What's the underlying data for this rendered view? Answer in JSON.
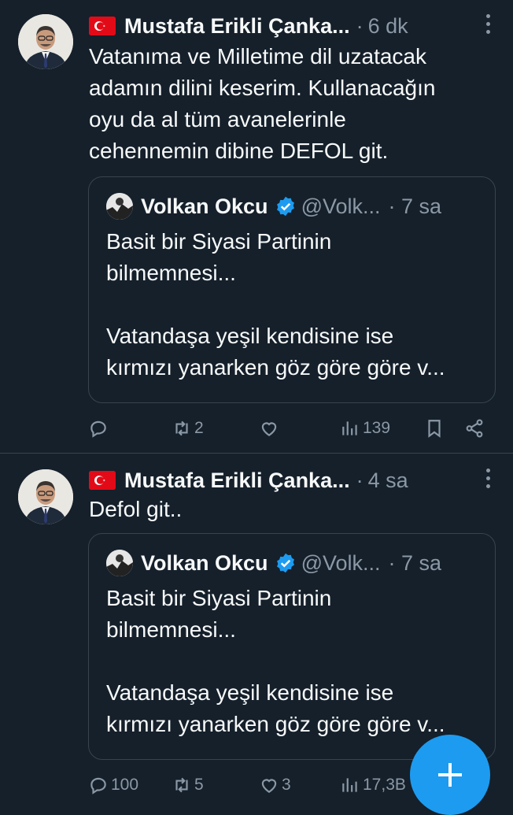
{
  "tweets": [
    {
      "author": "Mustafa Erikli Çanka...",
      "time": "6 dk",
      "text_lines": [
        "Vatanıma ve Milletime dil uzatacak",
        "adamın dilini keserim. Kullanacağın",
        "oyu da al tüm avanelerinle",
        "cehennemin dibine DEFOL git."
      ],
      "quote": {
        "author": "Volkan Okcu",
        "handle": "@Volk...",
        "time": "7 sa",
        "lines": [
          "Basit bir Siyasi Partinin",
          "bilmemnesi...",
          "",
          "Vatandaşa yeşil kendisine ise",
          "kırmızı yanarken göz göre göre v..."
        ]
      },
      "actions": {
        "replies": "",
        "retweets": "2",
        "likes": "",
        "views": "139"
      }
    },
    {
      "author": "Mustafa Erikli Çanka...",
      "time": "4 sa",
      "text_lines": [
        "Defol git.."
      ],
      "quote": {
        "author": "Volkan Okcu",
        "handle": "@Volk...",
        "time": "7 sa",
        "lines": [
          "Basit bir Siyasi Partinin",
          "bilmemnesi...",
          "",
          "Vatandaşa yeşil kendisine ise",
          "kırmızı yanarken göz göre göre v..."
        ]
      },
      "actions": {
        "replies": "100",
        "retweets": "5",
        "likes": "3",
        "views": "17,3B"
      }
    }
  ],
  "colors": {
    "background": "#15202b",
    "accent": "#1d9bf0",
    "muted": "#8b98a5",
    "border": "#38444d"
  },
  "icons": [
    "turkish-flag-icon",
    "more-icon",
    "verified-icon",
    "reply-icon",
    "retweet-icon",
    "like-icon",
    "views-icon",
    "bookmark-icon",
    "share-icon",
    "compose-icon"
  ]
}
